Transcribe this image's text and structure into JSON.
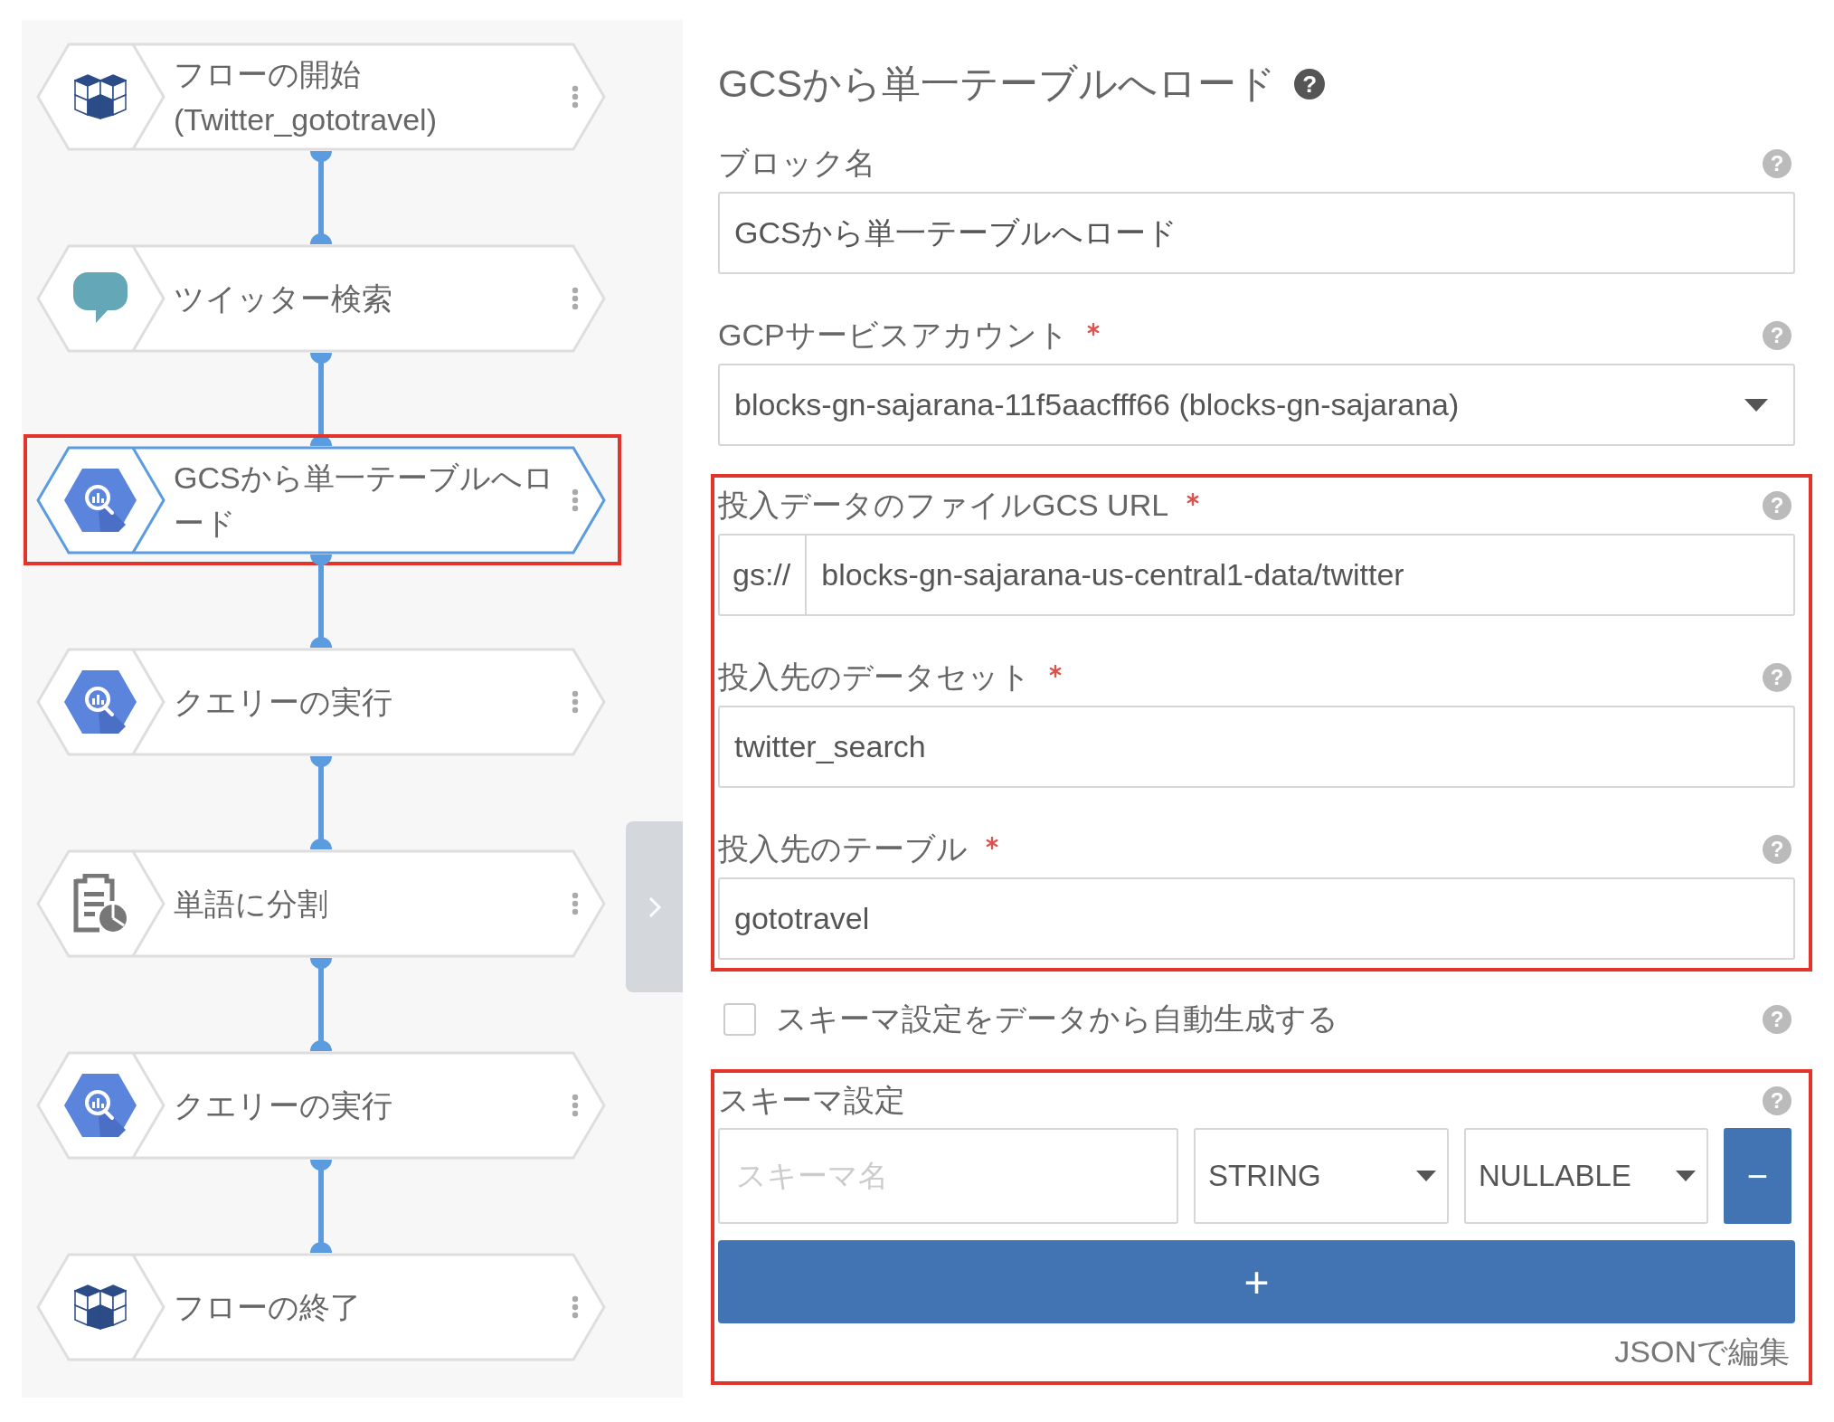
{
  "flow": {
    "nodes": [
      {
        "label": "フローの開始",
        "sublabel": "(Twitter_gototravel)",
        "kind": "cube",
        "selected": false,
        "highlighted": false
      },
      {
        "label": "ツイッター検索",
        "kind": "chat",
        "selected": false,
        "highlighted": false
      },
      {
        "label": "GCSから単一テーブルへロード",
        "kind": "bigquery",
        "selected": true,
        "highlighted": true
      },
      {
        "label": "クエリーの実行",
        "kind": "bigquery",
        "selected": false,
        "highlighted": false
      },
      {
        "label": "単語に分割",
        "kind": "document",
        "selected": false,
        "highlighted": false
      },
      {
        "label": "クエリーの実行",
        "kind": "bigquery",
        "selected": false,
        "highlighted": false
      },
      {
        "label": "フローの終了",
        "kind": "cube",
        "selected": false,
        "highlighted": false
      }
    ]
  },
  "form": {
    "title": "GCSから単一テーブルへロード",
    "title_help": "?",
    "sections": [
      {
        "highlighted": false,
        "items": [
          {
            "kind": "text",
            "label": "ブロック名",
            "required": false,
            "help": "?",
            "value": "GCSから単一テーブルへロード"
          },
          {
            "kind": "select",
            "label": "GCPサービスアカウント",
            "required": true,
            "help": "?",
            "value": "blocks-gn-sajarana-11f5aacfff66 (blocks-gn-sajarana)"
          }
        ]
      },
      {
        "highlighted": true,
        "items": [
          {
            "kind": "prefixed",
            "label": "投入データのファイルGCS URL",
            "required": true,
            "help": "?",
            "prefix": "gs://",
            "value": "blocks-gn-sajarana-us-central1-data/twitter"
          },
          {
            "kind": "text",
            "label": "投入先のデータセット",
            "required": true,
            "help": "?",
            "value": "twitter_search"
          },
          {
            "kind": "text",
            "label": "投入先のテーブル",
            "required": true,
            "help": "?",
            "value": "gototravel"
          }
        ]
      },
      {
        "highlighted": false,
        "items": [
          {
            "kind": "checkbox",
            "label": "スキーマ設定をデータから自動生成する",
            "checked": false,
            "help": "?"
          }
        ]
      },
      {
        "highlighted": true,
        "items": [
          {
            "kind": "schema",
            "label": "スキーマ設定",
            "help": "?",
            "rows": [
              {
                "name_placeholder": "スキーマ名",
                "type": "STRING",
                "mode": "NULLABLE",
                "remove": "−"
              }
            ],
            "add": "+",
            "json_link": "JSONで編集"
          }
        ]
      }
    ]
  }
}
